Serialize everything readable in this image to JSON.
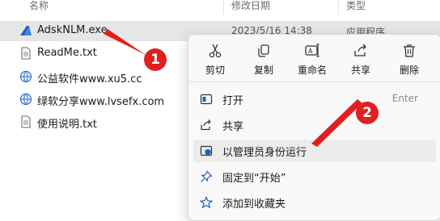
{
  "columns": {
    "name": "名称",
    "date": "修改日期",
    "type": "类型"
  },
  "files": [
    {
      "name": "AdskNLM.exe",
      "date": "2023/5/16 14:38",
      "type": "应用程序",
      "icon": "autodesk-exe-icon"
    },
    {
      "name": "ReadMe.txt",
      "date": "",
      "type": "",
      "icon": "text-file-icon"
    },
    {
      "name": "公益软件www.xu5.cc",
      "date": "",
      "type": "",
      "icon": "internet-shortcut-icon"
    },
    {
      "name": "绿软分享www.lvsefx.com",
      "date": "",
      "type": "",
      "icon": "internet-shortcut-icon"
    },
    {
      "name": "使用说明.txt",
      "date": "",
      "type": "",
      "icon": "text-file-icon"
    }
  ],
  "context_menu": {
    "quick_actions": [
      {
        "label": "剪切",
        "icon": "scissors-icon"
      },
      {
        "label": "复制",
        "icon": "copy-icon"
      },
      {
        "label": "重命名",
        "icon": "rename-icon"
      },
      {
        "label": "共享",
        "icon": "share-icon"
      },
      {
        "label": "删除",
        "icon": "trash-icon"
      }
    ],
    "items": [
      {
        "label": "打开",
        "shortcut": "Enter",
        "icon": "open-window-icon"
      },
      {
        "label": "共享",
        "shortcut": "",
        "icon": "share-icon"
      },
      {
        "label": "以管理员身份运行",
        "shortcut": "",
        "icon": "uac-shield-icon"
      },
      {
        "label": "固定到“开始”",
        "shortcut": "",
        "icon": "pin-icon"
      },
      {
        "label": "添加到收藏夹",
        "shortcut": "",
        "icon": "star-icon"
      }
    ]
  },
  "annotations": [
    {
      "number": "1"
    },
    {
      "number": "2"
    }
  ],
  "colors": {
    "annotation_red": "#e02020",
    "selection": "#e6e6e6",
    "accent_blue": "#1f5fbf"
  }
}
